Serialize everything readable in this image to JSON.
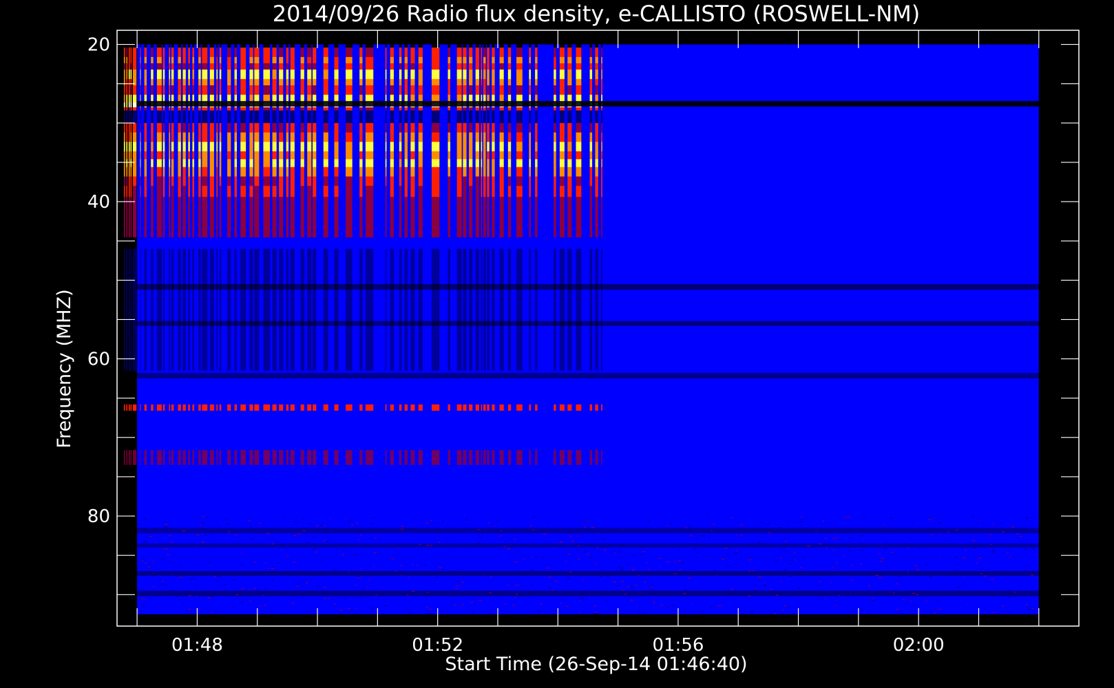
{
  "chart_data": {
    "type": "heatmap",
    "title": "2014/09/26  Radio flux density, e-CALLISTO (ROSWELL-NM)",
    "xlabel": "Start Time (26-Sep-14 01:46:40)",
    "ylabel": "Frequency (MHZ)",
    "x_unit": "time (UT)",
    "x_ticks": [
      "01:48",
      "01:52",
      "01:56",
      "02:00"
    ],
    "x_minor_tick_minutes": [
      "01:47",
      "01:48",
      "01:49",
      "01:50",
      "01:51",
      "01:52",
      "01:53",
      "01:54",
      "01:55",
      "01:56",
      "01:57",
      "01:58",
      "01:59",
      "02:00",
      "02:01",
      "02:02"
    ],
    "x_range": [
      "01:46:40",
      "02:02:40"
    ],
    "data_time_range": [
      "01:47:00",
      "02:02:00"
    ],
    "y_ticks": [
      20,
      40,
      60,
      80
    ],
    "y_minor_ticks": [
      20,
      25,
      30,
      35,
      40,
      45,
      50,
      55,
      60,
      65,
      70,
      75,
      80,
      85,
      90
    ],
    "y_range": [
      18.2,
      94.0
    ],
    "y_inverted": true,
    "data_freq_range": [
      20,
      92.5
    ],
    "colormap": [
      "#000000",
      "#00007a",
      "#0000ff",
      "#8a0040",
      "#ff2000",
      "#ff8c00",
      "#ffff40",
      "#ffffe6"
    ],
    "background_color": "#000000",
    "foreground_color": "#ffffff",
    "bursts_minutes_utc": [
      [
        1.78,
        1.8
      ],
      [
        1.82,
        1.84
      ],
      [
        1.86,
        1.88
      ],
      [
        1.89,
        1.91
      ],
      [
        1.93,
        1.99
      ],
      [
        2.05,
        2.06
      ],
      [
        2.12,
        2.16
      ],
      [
        2.23,
        2.27
      ],
      [
        2.33,
        2.41
      ],
      [
        2.43,
        2.46
      ],
      [
        2.53,
        2.55
      ],
      [
        2.57,
        2.61
      ],
      [
        2.68,
        2.73
      ],
      [
        2.76,
        2.81
      ],
      [
        2.85,
        2.88
      ],
      [
        2.92,
        2.95
      ],
      [
        3.02,
        3.06
      ],
      [
        3.08,
        3.17
      ],
      [
        3.21,
        3.28
      ],
      [
        3.32,
        3.34
      ],
      [
        3.37,
        3.4
      ],
      [
        3.5,
        3.56
      ],
      [
        3.62,
        3.66
      ],
      [
        3.72,
        3.81
      ],
      [
        3.87,
        3.93
      ],
      [
        3.95,
        4.03
      ],
      [
        4.1,
        4.21
      ],
      [
        4.25,
        4.32
      ],
      [
        4.36,
        4.43
      ],
      [
        4.48,
        4.52
      ],
      [
        4.55,
        4.62
      ],
      [
        4.72,
        4.78
      ],
      [
        4.83,
        4.9
      ],
      [
        4.92,
        4.98
      ],
      [
        5.1,
        5.18
      ],
      [
        5.28,
        5.35
      ],
      [
        5.47,
        5.58
      ],
      [
        5.7,
        5.75
      ],
      [
        5.8,
        5.93
      ],
      [
        6.13,
        6.15
      ],
      [
        6.21,
        6.27
      ],
      [
        6.36,
        6.4
      ],
      [
        6.45,
        6.5
      ],
      [
        6.55,
        6.62
      ],
      [
        6.68,
        6.75
      ],
      [
        6.9,
        7.03
      ],
      [
        7.17,
        7.21
      ],
      [
        7.32,
        7.4
      ],
      [
        7.42,
        7.48
      ],
      [
        7.52,
        7.58
      ],
      [
        7.63,
        7.69
      ],
      [
        7.72,
        7.74
      ],
      [
        7.76,
        7.8
      ],
      [
        7.82,
        7.86
      ],
      [
        7.9,
        7.95
      ],
      [
        8.03,
        8.1
      ],
      [
        8.17,
        8.22
      ],
      [
        8.31,
        8.41
      ],
      [
        8.52,
        8.55
      ],
      [
        8.62,
        8.66
      ],
      [
        8.93,
        8.97
      ],
      [
        9.03,
        9.11
      ],
      [
        9.16,
        9.23
      ],
      [
        9.3,
        9.39
      ],
      [
        9.53,
        9.57
      ],
      [
        9.62,
        9.67
      ],
      [
        9.72,
        9.74
      ]
    ]
  }
}
